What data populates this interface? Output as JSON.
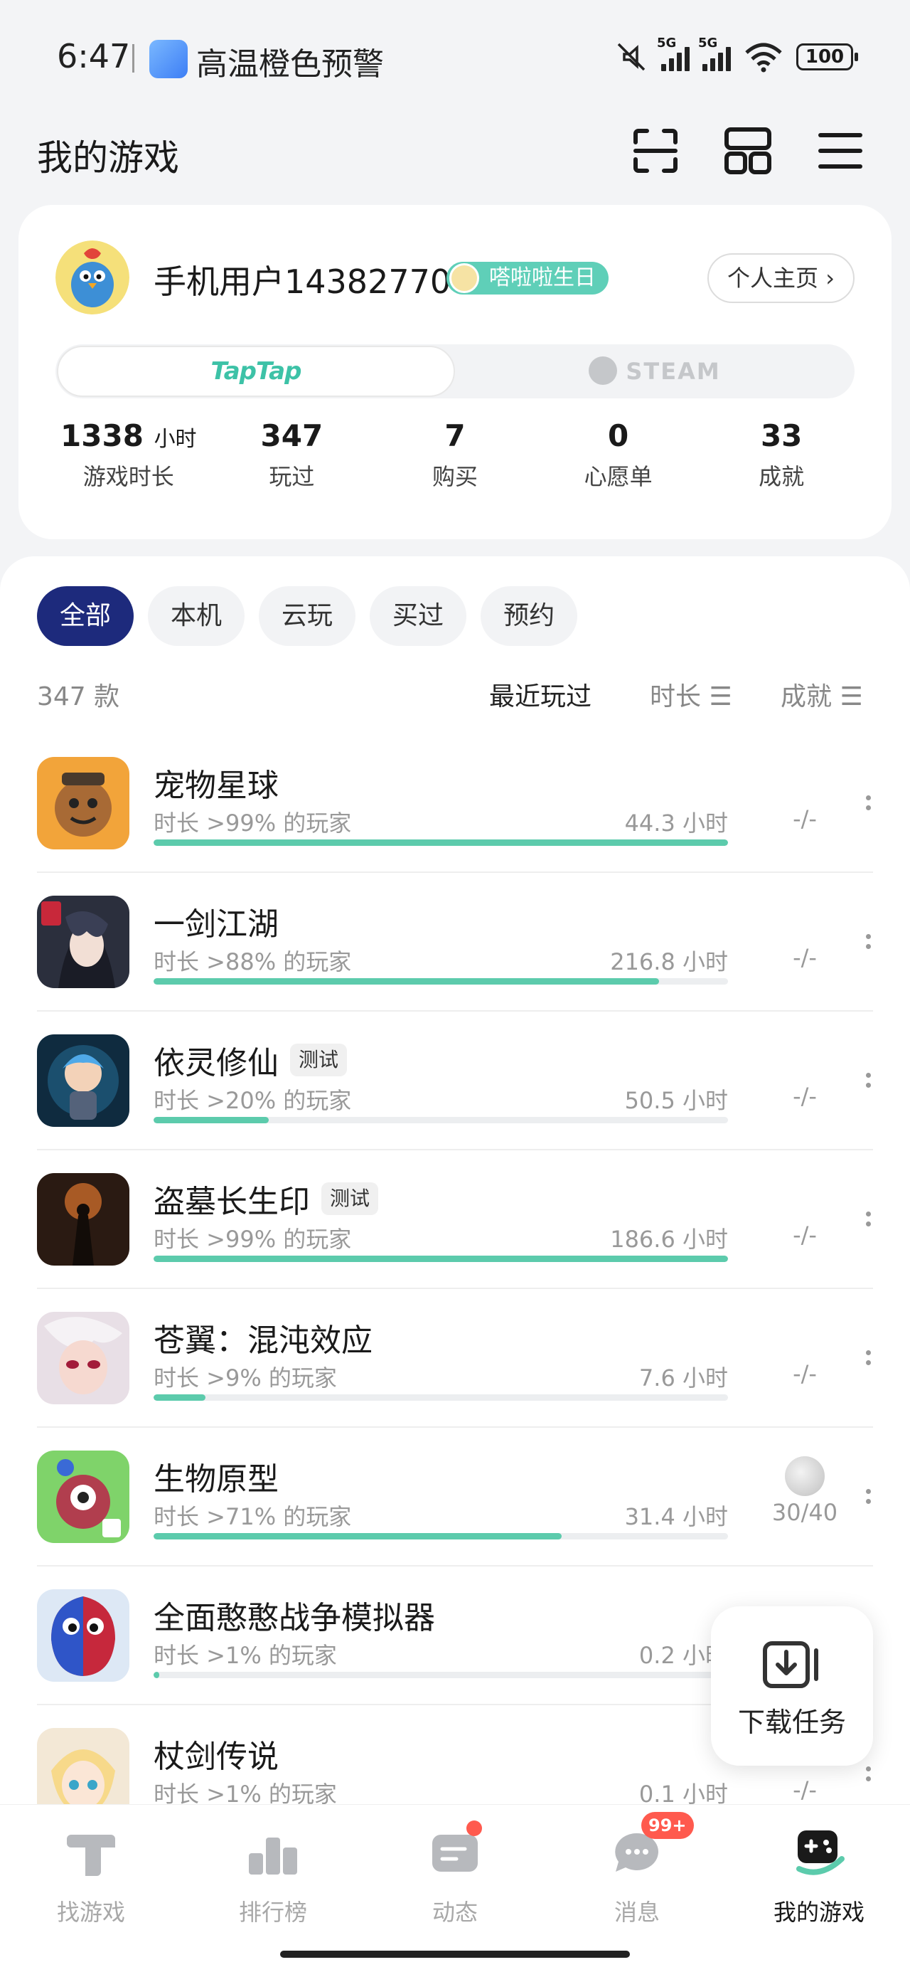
{
  "status_bar": {
    "time": "6:47",
    "weather_alert": "高温橙色预警",
    "battery": "100"
  },
  "header": {
    "title": "我的游戏",
    "icons": [
      "scan-icon",
      "grid-icon",
      "menu-icon"
    ]
  },
  "profile": {
    "username": "手机用户14382770",
    "badge": "嗒啦啦生日",
    "home_button": "个人主页 ›",
    "platforms": [
      "TapTap",
      "STEAM"
    ],
    "active_platform": "TapTap",
    "stats": [
      {
        "value": "1338",
        "unit": "小时",
        "label": "游戏时长"
      },
      {
        "value": "347",
        "unit": "",
        "label": "玩过"
      },
      {
        "value": "7",
        "unit": "",
        "label": "购买"
      },
      {
        "value": "0",
        "unit": "",
        "label": "心愿单"
      },
      {
        "value": "33",
        "unit": "",
        "label": "成就"
      }
    ]
  },
  "filters": {
    "chips": [
      "全部",
      "本机",
      "云玩",
      "买过",
      "预约"
    ],
    "active": "全部"
  },
  "list_meta": {
    "count": "347 款",
    "sort_recent": "最近玩过",
    "sort_duration": "时长 ☰",
    "sort_achievement": "成就 ☰"
  },
  "games": [
    {
      "name": "宠物星球",
      "badge": "",
      "rank": "时长 >99% 的玩家",
      "hours": "44.3 小时",
      "progress": 1.0,
      "achievement": "-/-",
      "has_achv_icon": false
    },
    {
      "name": "一剑江湖",
      "badge": "",
      "rank": "时长 >88% 的玩家",
      "hours": "216.8 小时",
      "progress": 0.88,
      "achievement": "-/-",
      "has_achv_icon": false
    },
    {
      "name": "依灵修仙",
      "badge": "测试",
      "rank": "时长 >20% 的玩家",
      "hours": "50.5 小时",
      "progress": 0.2,
      "achievement": "-/-",
      "has_achv_icon": false
    },
    {
      "name": "盗墓长生印",
      "badge": "测试",
      "rank": "时长 >99% 的玩家",
      "hours": "186.6 小时",
      "progress": 1.0,
      "achievement": "-/-",
      "has_achv_icon": false
    },
    {
      "name": "苍翼：混沌效应",
      "badge": "",
      "rank": "时长 >9% 的玩家",
      "hours": "7.6 小时",
      "progress": 0.09,
      "achievement": "-/-",
      "has_achv_icon": false
    },
    {
      "name": "生物原型",
      "badge": "",
      "rank": "时长 >71% 的玩家",
      "hours": "31.4 小时",
      "progress": 0.71,
      "achievement": "30/40",
      "has_achv_icon": true
    },
    {
      "name": "全面憨憨战争模拟器",
      "badge": "",
      "rank": "时长 >1% 的玩家",
      "hours": "0.2 小时",
      "progress": 0.01,
      "achievement": "",
      "has_achv_icon": false
    },
    {
      "name": "杖剑传说",
      "badge": "",
      "rank": "时长 >1% 的玩家",
      "hours": "0.1 小时",
      "progress": 0.01,
      "achievement": "-/-",
      "has_achv_icon": false
    }
  ],
  "download_task": {
    "label": "下载任务"
  },
  "bottom_nav": {
    "items": [
      "找游戏",
      "排行榜",
      "动态",
      "消息",
      "我的游戏"
    ],
    "active": "我的游戏",
    "message_badge": "99+"
  },
  "colors": {
    "accent": "#5ccbac",
    "chip_active": "#1d2a7c",
    "badge_red": "#ff5a4e"
  }
}
